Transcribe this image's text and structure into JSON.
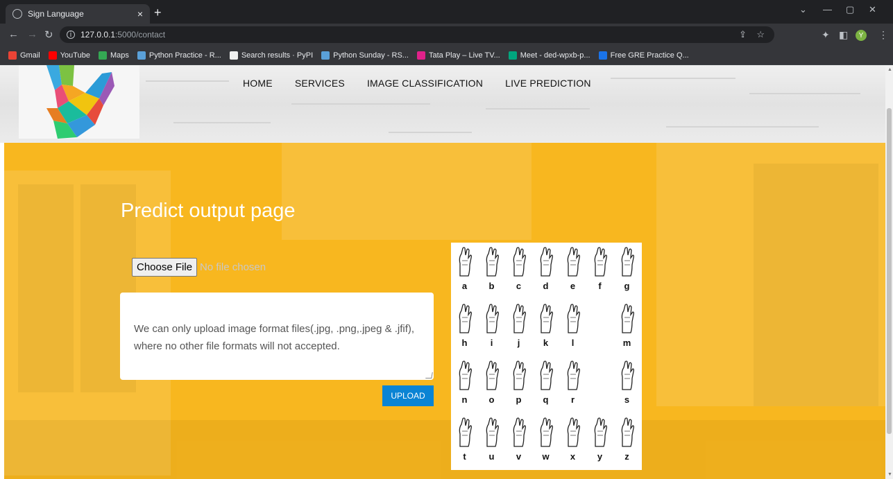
{
  "browser": {
    "tab_title": "Sign Language",
    "new_tab": "+",
    "tab_close": "×",
    "url_host": "127.0.0.1",
    "url_path": ":5000/contact",
    "profile_initial": "Y",
    "bookmarks": [
      {
        "label": "Gmail",
        "color": "#ea4335"
      },
      {
        "label": "YouTube",
        "color": "#ff0000"
      },
      {
        "label": "Maps",
        "color": "#34a853"
      },
      {
        "label": "Python Practice - R...",
        "color": "#5aa0d8"
      },
      {
        "label": "Search results · PyPI",
        "color": "#f0f0f0"
      },
      {
        "label": "Python Sunday - RS...",
        "color": "#5aa0d8"
      },
      {
        "label": "Tata Play – Live TV...",
        "color": "#e0218a"
      },
      {
        "label": "Meet - ded-wpxb-p...",
        "color": "#00a67e"
      },
      {
        "label": "Free GRE Practice Q...",
        "color": "#1a73e8"
      }
    ]
  },
  "nav": {
    "items": [
      "HOME",
      "SERVICES",
      "IMAGE CLASSIFICATION",
      "LIVE PREDICTION"
    ]
  },
  "main": {
    "title": "Predict output page",
    "choose_file_label": "Choose File",
    "no_file_text": "No file chosen",
    "description": "We can only upload image format files(.jpg, .png,.jpeg & .jfif), where no other file formats will not accepted.",
    "upload_label": "UPLOAD"
  },
  "alphabet": [
    "a",
    "b",
    "c",
    "d",
    "e",
    "f",
    "g",
    "h",
    "i",
    "j",
    "k",
    "l",
    "m",
    "n",
    "o",
    "p",
    "q",
    "r",
    "s",
    "t",
    "u",
    "v",
    "w",
    "x",
    "y",
    "z"
  ],
  "colors": {
    "hero_bg": "#f8b71f",
    "upload_button": "#0a84d4"
  }
}
